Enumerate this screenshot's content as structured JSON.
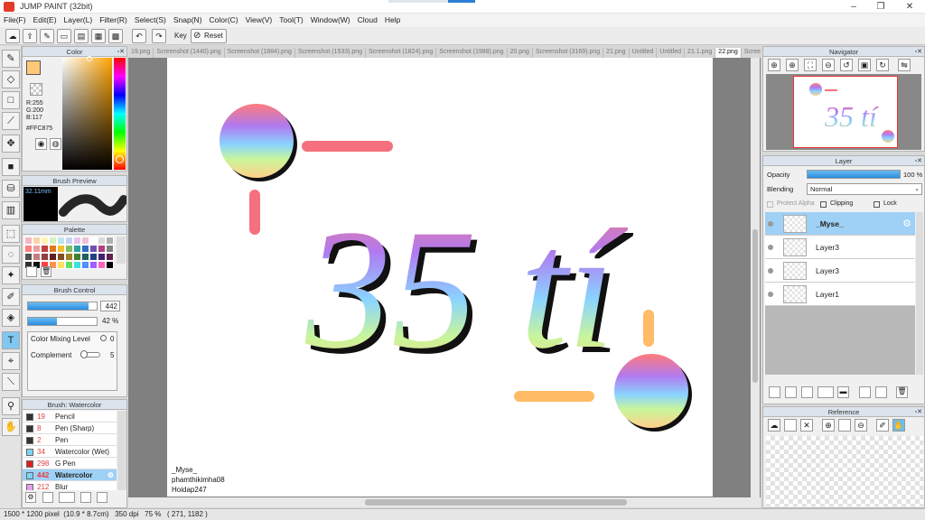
{
  "window": {
    "title": "JUMP PAINT (32bit)"
  },
  "menu": [
    "File(F)",
    "Edit(E)",
    "Layer(L)",
    "Filter(R)",
    "Select(S)",
    "Snap(N)",
    "Color(C)",
    "View(V)",
    "Tool(T)",
    "Window(W)",
    "Cloud",
    "Help"
  ],
  "toolbar": {
    "key_label": "Key",
    "reset_label": "Reset"
  },
  "color_panel": {
    "title": "Color",
    "r": "R:255",
    "g": "G:200",
    "b": "B:117",
    "hex": "#FFC875",
    "fg": "#ffc875"
  },
  "brush_preview": {
    "title": "Brush Preview",
    "size": "32.11mm"
  },
  "palette": {
    "title": "Palette",
    "colors": [
      "#f4b6c2",
      "#f9d4a8",
      "#fff2b3",
      "#d7f0c0",
      "#bde6f0",
      "#c6d2f5",
      "#e2c6f0",
      "#f0c0d8",
      "#ffffff",
      "#d9d9d9",
      "#b0b0b0",
      "#ff7f7f",
      "#e8a0a0",
      "#c04040",
      "#e07820",
      "#f0c030",
      "#80c060",
      "#30a0a0",
      "#3070c0",
      "#7050b0",
      "#b04080",
      "#808080",
      "#505050",
      "#c08080",
      "#904040",
      "#602020",
      "#805020",
      "#a08020",
      "#408030",
      "#206060",
      "#204080",
      "#402070",
      "#602050",
      "#303030",
      "#101010",
      "#ff4040",
      "#ff9050",
      "#ffe060",
      "#60e060",
      "#40e0e0",
      "#5090ff",
      "#a060ff",
      "#ff60c0",
      "#000000"
    ]
  },
  "brush_control": {
    "title": "Brush Control",
    "size_value": "442",
    "opacity_value": "42 %",
    "size_fraction": 0.88,
    "opacity_fraction": 0.42,
    "mix_label": "Color Mixing Level",
    "mix_value": "0",
    "complement_label": "Complement",
    "complement_value": "5"
  },
  "brush_list": {
    "title": "Brush: Watercolor",
    "items": [
      {
        "size": "19",
        "name": "Pencil",
        "color": "#333333"
      },
      {
        "size": "8",
        "name": "Pen (Sharp)",
        "color": "#333333"
      },
      {
        "size": "2",
        "name": "Pen",
        "color": "#333333"
      },
      {
        "size": "34",
        "name": "Watercolor (Wet)",
        "color": "#7dd3f5"
      },
      {
        "size": "298",
        "name": "G Pen",
        "color": "#e02020"
      },
      {
        "size": "442",
        "name": "Watercolor",
        "color": "#7dd3f5"
      },
      {
        "size": "212",
        "name": "Blur",
        "color": "#e5a0e5"
      }
    ],
    "selected_index": 5
  },
  "tabs": [
    "19.png",
    "Screenshot (1440).png",
    "Screenshot (1884).png",
    "Screenshot (1533).png",
    "Screenshot (1824).png",
    "Screenshot (1988).png",
    "20.png",
    "Screenshot (3169).png",
    "21.png",
    "Untitled",
    "Untitled",
    "21.1.png",
    "22.png",
    "Screens"
  ],
  "active_tab_index": 12,
  "canvas": {
    "main_text": "35 tí",
    "watermark": [
      "_Myse_",
      "phamthikimha08",
      "Hoidap247"
    ]
  },
  "navigator": {
    "title": "Navigator"
  },
  "layer_panel": {
    "title": "Layer",
    "opacity_label": "Opacity",
    "opacity_value": "100 %",
    "opacity_fraction": 1.0,
    "blending_label": "Blending",
    "blending_value": "Normal",
    "protect_alpha": "Protect Alpha",
    "clipping": "Clipping",
    "lock": "Lock",
    "layers": [
      "_Myse_",
      "Layer3",
      "Layer3",
      "Layer1"
    ],
    "selected_index": 0
  },
  "reference": {
    "title": "Reference"
  },
  "status": {
    "dims": "1500 * 1200 pixel",
    "size_cm": "(10.9 * 8.7cm)",
    "dpi": "350 dpi",
    "zoom": "75 %",
    "coords": "( 271, 1182 )"
  }
}
